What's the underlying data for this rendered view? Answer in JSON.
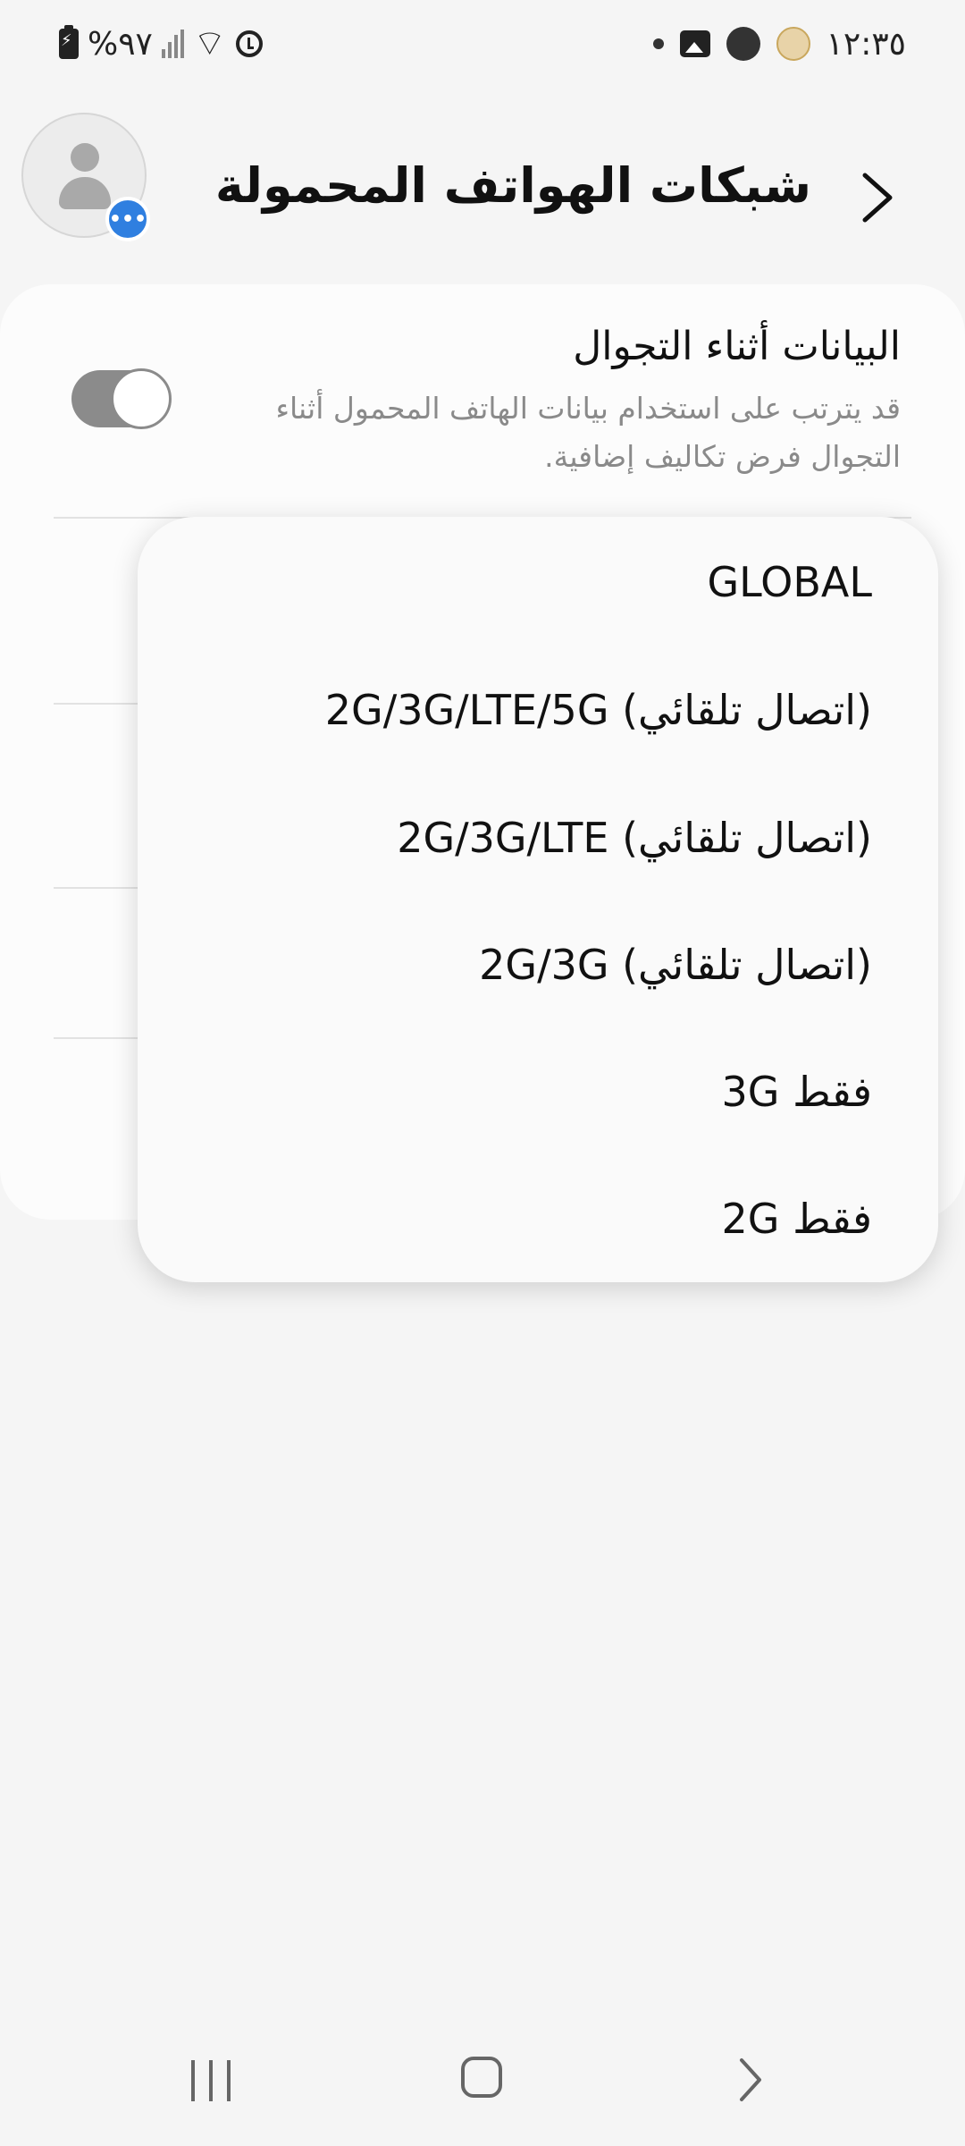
{
  "status_bar": {
    "time": "١٢:٣٥",
    "battery": "%٩٧"
  },
  "header": {
    "title": "شبكات الهواتف المحمولة"
  },
  "roaming": {
    "title": "البيانات أثناء التجوال",
    "description": "قد يترتب على استخدام بيانات الهاتف المحمول أثناء التجوال فرض تكاليف إضافية.",
    "enabled": false
  },
  "network_mode_menu": {
    "options": [
      "GLOBAL",
      "2G/3G/LTE/5G (اتصال تلقائي)",
      "2G/3G/LTE (اتصال تلقائي)",
      "2G/3G (اتصال تلقائي)",
      "3G فقط",
      "2G فقط"
    ]
  },
  "icons": {
    "back": "chevron-right-icon",
    "avatar": "user-avatar-icon",
    "badge": "chat-bubble-icon"
  }
}
